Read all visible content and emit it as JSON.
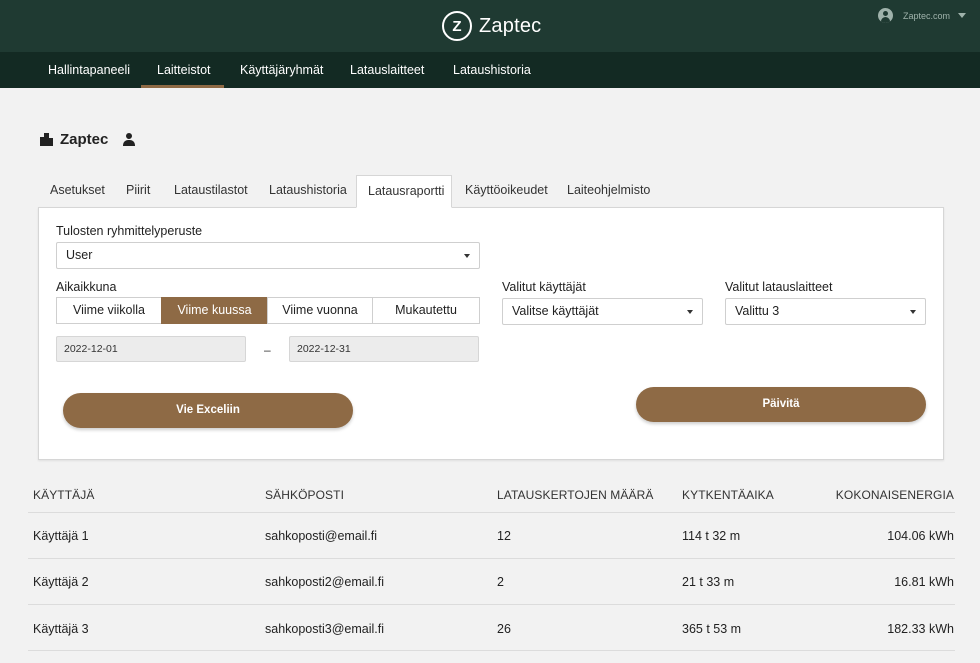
{
  "header": {
    "brand_logo_letter": "Z",
    "brand_name": "Zaptec",
    "account_name": "Zaptec.com"
  },
  "main_nav": {
    "items": [
      {
        "label": "Hallintapaneeli"
      },
      {
        "label": "Laitteistot",
        "active": true
      },
      {
        "label": "Käyttäjäryhmät"
      },
      {
        "label": "Latauslaitteet"
      },
      {
        "label": "Lataushistoria"
      }
    ]
  },
  "page": {
    "title": "Zaptec"
  },
  "sub_tabs": {
    "items": [
      {
        "label": "Asetukset"
      },
      {
        "label": "Piirit"
      },
      {
        "label": "Lataustilastot"
      },
      {
        "label": "Lataushistoria"
      },
      {
        "label": "Latausraportti",
        "active": true
      },
      {
        "label": "Käyttöoikeudet"
      },
      {
        "label": "Laiteohjelmisto"
      }
    ]
  },
  "report": {
    "grouping_label": "Tulosten ryhmittelyperuste",
    "grouping_value": "User",
    "period_label": "Aikaikkuna",
    "period_options": [
      {
        "label": "Viime viikolla"
      },
      {
        "label": "Viime kuussa",
        "active": true
      },
      {
        "label": "Viime vuonna"
      },
      {
        "label": "Mukautettu"
      }
    ],
    "date_from": "2022-12-01",
    "date_separator": "–",
    "date_to": "2022-12-31",
    "users_label": "Valitut käyttäjät",
    "users_value": "Valitse käyttäjät",
    "chargers_label": "Valitut latauslaitteet",
    "chargers_value": "Valittu 3",
    "export_button": "Vie Exceliin",
    "update_button": "Päivitä"
  },
  "table": {
    "headers": [
      "KÄYTTÄJÄ",
      "SÄHKÖPOSTI",
      "LATAUSKERTOJEN MÄÄRÄ",
      "KYTKENTÄAIKA",
      "KOKONAISENERGIA"
    ],
    "rows": [
      [
        "Käyttäjä 1",
        "sahkoposti@email.fi",
        "12",
        "114 t 32 m",
        "104.06 kWh"
      ],
      [
        "Käyttäjä 2",
        "sahkoposti2@email.fi",
        "2",
        "21 t 33 m",
        "16.81 kWh"
      ],
      [
        "Käyttäjä 3",
        "sahkoposti3@email.fi",
        "26",
        "365 t 53 m",
        "182.33 kWh"
      ]
    ]
  },
  "colors": {
    "header_bg": "#1f3a32",
    "nav_bg": "#132a23",
    "accent": "#8e6a45",
    "page_bg": "#f2f2f2"
  }
}
